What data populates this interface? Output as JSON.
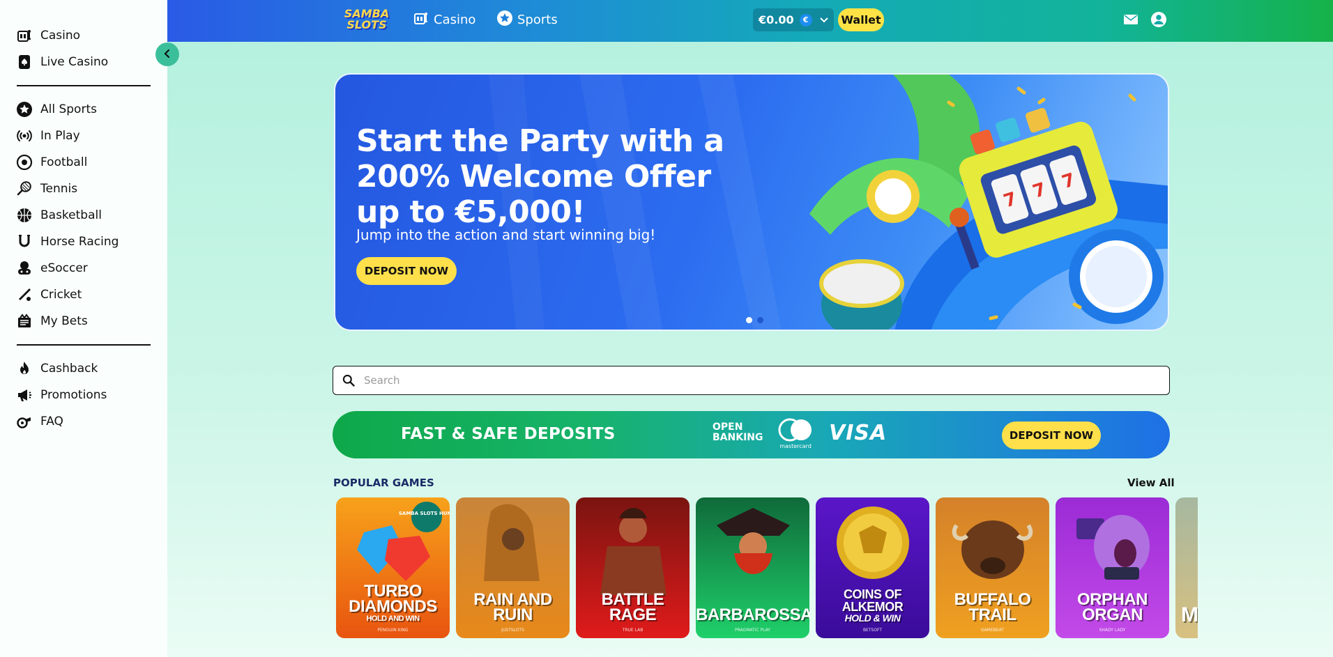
{
  "sidebar": {
    "collapse_icon": "chevron-left-icon",
    "groups": [
      [
        {
          "label": "Casino",
          "icon": "slot-machine-icon"
        },
        {
          "label": "Live Casino",
          "icon": "card-spade-icon"
        }
      ],
      [
        {
          "label": "All Sports",
          "icon": "star-badge-icon"
        },
        {
          "label": "In Play",
          "icon": "broadcast-icon"
        },
        {
          "label": "Football",
          "icon": "football-icon"
        },
        {
          "label": "Tennis",
          "icon": "tennis-racket-icon"
        },
        {
          "label": "Basketball",
          "icon": "basketball-icon"
        },
        {
          "label": "Horse Racing",
          "icon": "horseshoe-icon"
        },
        {
          "label": "eSoccer",
          "icon": "gamepad-icon"
        },
        {
          "label": "Cricket",
          "icon": "cricket-bat-icon"
        },
        {
          "label": "My Bets",
          "icon": "ticket-icon"
        }
      ],
      [
        {
          "label": "Cashback",
          "icon": "flame-icon"
        },
        {
          "label": "Promotions",
          "icon": "megaphone-icon"
        },
        {
          "label": "FAQ",
          "icon": "whistle-icon"
        }
      ]
    ]
  },
  "header": {
    "logo_text": [
      "SAMBA",
      "SLOTS"
    ],
    "nav": [
      {
        "label": "Casino",
        "icon": "slot-machine-icon"
      },
      {
        "label": "Sports",
        "icon": "star-badge-icon"
      }
    ],
    "balance": "€0.00",
    "currency_symbol": "€",
    "wallet_label": "Wallet",
    "icons": [
      "mail-icon",
      "user-icon"
    ]
  },
  "hero": {
    "title": "Start the Party with a 200% Welcome Offer up to €5,000!",
    "subtitle": "Jump into the action and start winning big!",
    "cta": "DEPOSIT NOW",
    "slides": 2,
    "active_slide": 1
  },
  "search": {
    "placeholder": "Search",
    "value": ""
  },
  "deposit_banner": {
    "title": "FAST & SAFE DEPOSITS",
    "open_banking": [
      "OPEN",
      "BANKING"
    ],
    "mastercard_label": "mastercard",
    "visa_label": "VISA",
    "cta": "DEPOSIT NOW"
  },
  "popular_games": {
    "title": "POPULAR GAMES",
    "view_all": "View All",
    "games": [
      {
        "name": "TURBO DIAMONDS",
        "sub": "HOLD AND WIN",
        "provider": "PENGUIN KING",
        "badge": "SAMBA SLOTS HUNT",
        "colors": [
          "#f7a21b",
          "#e8540f"
        ]
      },
      {
        "name": "RAIN AND RUIN",
        "sub": "",
        "provider": "JUSTSLOTS",
        "badge": "",
        "colors": [
          "#c9853a",
          "#e8891a"
        ]
      },
      {
        "name": "BATTLE RAGE",
        "sub": "",
        "provider": "TRUE LAB",
        "badge": "",
        "colors": [
          "#7a1410",
          "#e01b1b"
        ]
      },
      {
        "name": "BARBAROSSA",
        "sub": "",
        "provider": "PRAGMATIC PLAY",
        "badge": "",
        "colors": [
          "#0f6a3a",
          "#1fd06a"
        ]
      },
      {
        "name": "COINS OF ALKEMOR",
        "sub": "HOLD & WIN",
        "provider": "BETSOFT",
        "badge": "",
        "colors": [
          "#5a16c8",
          "#3a0c9a"
        ]
      },
      {
        "name": "BUFFALO TRAIL",
        "sub": "",
        "provider": "GAMEBEAT",
        "badge": "",
        "colors": [
          "#d4812a",
          "#f0a020"
        ]
      },
      {
        "name": "ORPHAN ORGAN",
        "sub": "",
        "provider": "SHADY LADY",
        "badge": "",
        "colors": [
          "#9b2bd6",
          "#c34ae8"
        ]
      },
      {
        "name": "MO",
        "sub": "",
        "provider": "",
        "badge": "",
        "colors": [
          "#a6b8a0",
          "#d8c080"
        ]
      }
    ]
  }
}
